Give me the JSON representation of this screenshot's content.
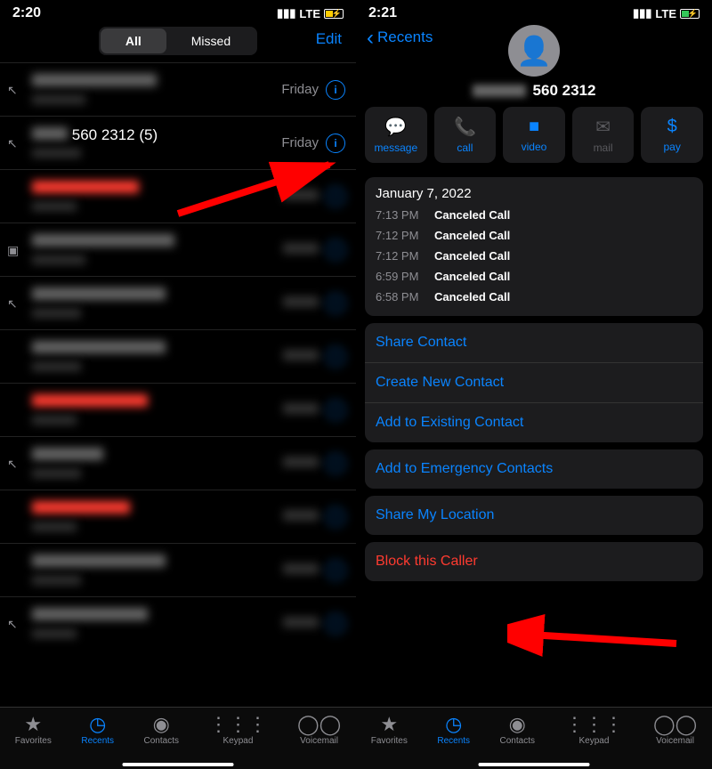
{
  "left": {
    "status": {
      "time": "2:20",
      "net": "LTE"
    },
    "segments": {
      "all": "All",
      "missed": "Missed"
    },
    "edit": "Edit",
    "row2": {
      "name": "560 2312 (5)",
      "date": "Friday"
    },
    "row1_date": "Friday",
    "tabs": {
      "fav": "Favorites",
      "rec": "Recents",
      "con": "Contacts",
      "key": "Keypad",
      "vm": "Voicemail"
    }
  },
  "right": {
    "status": {
      "time": "2:21",
      "net": "LTE"
    },
    "back": "Recents",
    "number": "560 2312",
    "actions": {
      "message": "message",
      "call": "call",
      "video": "video",
      "mail": "mail",
      "pay": "pay"
    },
    "calls": {
      "date": "January 7, 2022",
      "items": [
        {
          "t": "7:13 PM",
          "s": "Canceled Call"
        },
        {
          "t": "7:12 PM",
          "s": "Canceled Call"
        },
        {
          "t": "7:12 PM",
          "s": "Canceled Call"
        },
        {
          "t": "6:59 PM",
          "s": "Canceled Call"
        },
        {
          "t": "6:58 PM",
          "s": "Canceled Call"
        }
      ]
    },
    "opts": {
      "share": "Share Contact",
      "create": "Create New Contact",
      "add": "Add to Existing Contact",
      "emerg": "Add to Emergency Contacts",
      "loc": "Share My Location",
      "block": "Block this Caller"
    },
    "tabs": {
      "fav": "Favorites",
      "rec": "Recents",
      "con": "Contacts",
      "key": "Keypad",
      "vm": "Voicemail"
    }
  }
}
